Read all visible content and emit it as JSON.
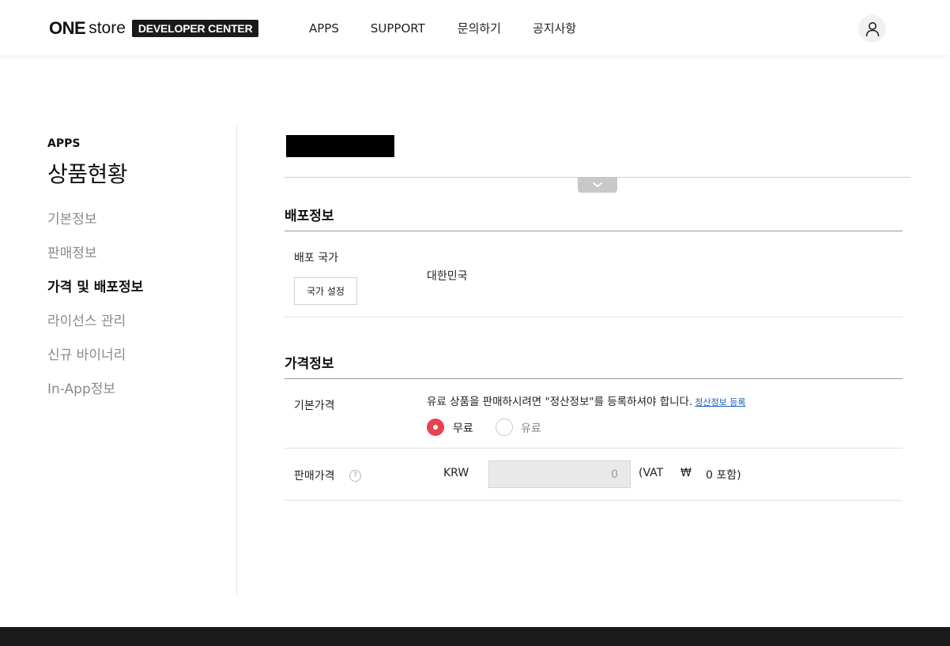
{
  "header": {
    "logo_one": "ONE",
    "logo_store": "store",
    "logo_badge": "DEVELOPER CENTER",
    "nav": [
      "APPS",
      "SUPPORT",
      "문의하기",
      "공지사항"
    ]
  },
  "sidebar": {
    "eyebrow": "APPS",
    "title": "상품현황",
    "items": [
      {
        "label": "기본정보",
        "active": false
      },
      {
        "label": "판매정보",
        "active": false
      },
      {
        "label": "가격 및 배포정보",
        "active": true
      },
      {
        "label": "라이선스 관리",
        "active": false
      },
      {
        "label": "신규 바이너리",
        "active": false
      },
      {
        "label": "In-App정보",
        "active": false
      }
    ]
  },
  "distribution": {
    "section_title": "배포정보",
    "country_label": "배포 국가",
    "country_button": "국가 설정",
    "country_value": "대한민국"
  },
  "pricing": {
    "section_title": "가격정보",
    "base_price_label": "기본가격",
    "notice_text": "유료 상품을 판매하시려면 \"정산정보\"를 등록하셔야 합니다.",
    "notice_link": "정산정보 등록",
    "radio_free": "무료",
    "radio_paid": "유료",
    "selected": "free",
    "sale_price_label": "판매가격",
    "help_icon_text": "?",
    "currency": "KRW",
    "price_value": "0",
    "vat_prefix": "(VAT",
    "won_symbol": "₩",
    "vat_suffix": "0 포함)"
  },
  "colors": {
    "accent": "#e8434d",
    "link": "#1f5fbf",
    "footer": "#1a1a1a"
  }
}
